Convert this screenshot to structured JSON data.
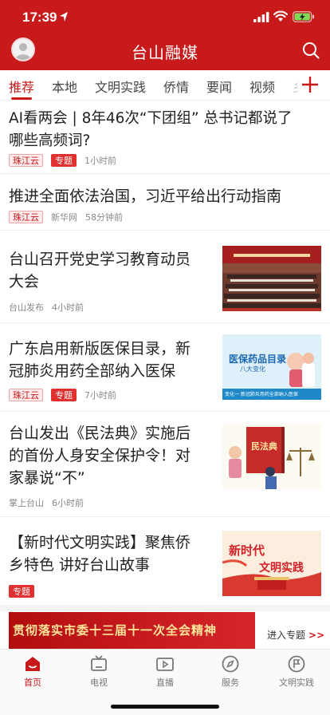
{
  "status_bar": {
    "time": "17:39"
  },
  "header": {
    "title": "台山融媒"
  },
  "tabs": [
    {
      "label": "推荐",
      "active": true
    },
    {
      "label": "本地"
    },
    {
      "label": "文明实践"
    },
    {
      "label": "侨情"
    },
    {
      "label": "要闻"
    },
    {
      "label": "视频"
    },
    {
      "label": "乡"
    }
  ],
  "feed": [
    {
      "title_lines": [
        "AI看两会 | 8年46次“下团组” 总书记都说了",
        "哪些高频词?"
      ],
      "tag": "珠江云",
      "special": "专题",
      "time": "1小时前"
    },
    {
      "title_lines": [
        "推进全面依法治国，习近平给出行动指南"
      ],
      "tag": "珠江云",
      "source": "新华网",
      "time": "58分钟前"
    },
    {
      "title_lines": [
        "台山召开党史学习教育动员",
        "大会"
      ],
      "source": "台山发布",
      "time": "4小时前",
      "image": "meeting-photo"
    },
    {
      "title_lines": [
        "广东启用新版医保目录，新",
        "冠肺炎用药全部纳入医保"
      ],
      "tag": "珠江云",
      "special": "专题",
      "time": "7小时前",
      "image": "medical-insurance-poster",
      "poster": {
        "heading": "医保药品目录",
        "subheading": "八大变化",
        "footer": "变化一 新冠肺炎用药全部纳入医保"
      }
    },
    {
      "title_lines": [
        "台山发出《民法典》实施后",
        "的首份人身安全保护令！对",
        "家暴说“不”"
      ],
      "source": "掌上台山",
      "time": "6小时前",
      "image": "civil-code-illustration",
      "poster": {
        "book": "民法典"
      }
    },
    {
      "title_lines": [
        "【新时代文明实践】聚焦侨",
        "乡特色 讲好台山故事"
      ],
      "special": "专题",
      "image": "civilization-poster",
      "poster": {
        "line1": "新时代",
        "line2": "文明实践"
      }
    }
  ],
  "banner": {
    "text": "贯彻落实市委十三届十一次全会精神",
    "enter_label": "进入专题",
    "enter_arrow": ">>"
  },
  "bottom_nav": [
    {
      "label": "首页",
      "icon": "home-icon",
      "active": true
    },
    {
      "label": "电视",
      "icon": "tv-icon"
    },
    {
      "label": "直播",
      "icon": "live-icon"
    },
    {
      "label": "服务",
      "icon": "compass-icon"
    },
    {
      "label": "文明实践",
      "icon": "flag-circle-icon"
    }
  ],
  "colors": {
    "brand": "#c8191b",
    "tag_bg": "#fde9e9",
    "special_tag": "#e03030"
  }
}
